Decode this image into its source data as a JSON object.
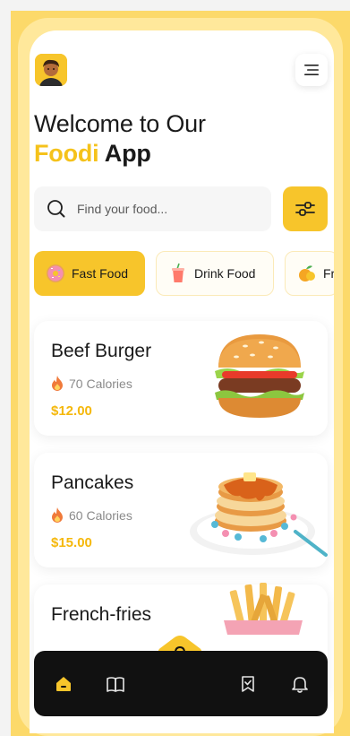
{
  "header": {
    "title_line1": "Welcome to Our",
    "title_accent": "Foodi",
    "title_rest": " App"
  },
  "search": {
    "placeholder": "Find your food..."
  },
  "categories": [
    {
      "label": "Fast Food",
      "icon": "donut-icon",
      "active": true
    },
    {
      "label": "Drink Food",
      "icon": "drink-cup-icon",
      "active": false
    },
    {
      "label": "Fr",
      "icon": "fruit-icon",
      "active": false
    }
  ],
  "foods": [
    {
      "name": "Beef Burger",
      "calories": "70 Calories",
      "price": "$12.00",
      "icon": "burger-icon"
    },
    {
      "name": "Pancakes",
      "calories": "60 Calories",
      "price": "$15.00",
      "icon": "pancakes-icon"
    },
    {
      "name": "French-fries",
      "icon": "fries-icon"
    }
  ],
  "nav": {
    "items": [
      "home-icon",
      "book-icon",
      "cart-icon",
      "bookmark-icon",
      "bell-icon"
    ]
  },
  "colors": {
    "accent": "#f7c52b",
    "price": "#f5b80c",
    "nav_bg": "#111111",
    "frame": "#fcd96a"
  }
}
